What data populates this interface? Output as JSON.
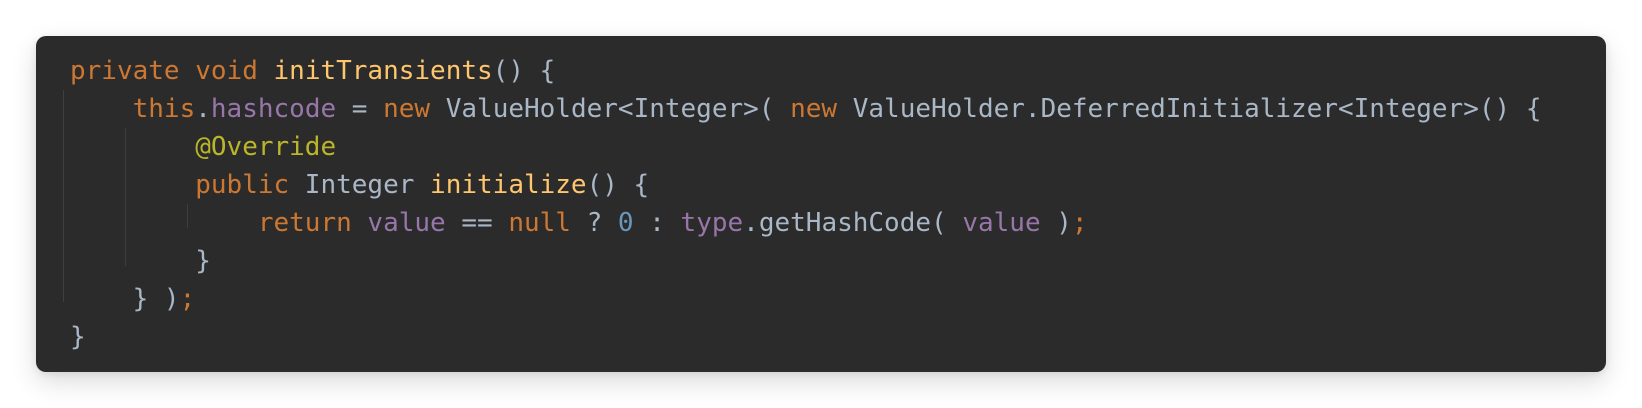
{
  "colors": {
    "background": "#2b2b2b",
    "keyword": "#cc7832",
    "method": "#ffc66d",
    "field": "#9876aa",
    "type": "#a9b7c6",
    "annotation": "#bbb529",
    "number": "#6897bb",
    "plain": "#a9b7c6"
  },
  "code": {
    "lines": [
      [
        {
          "text": "private",
          "kind": "keyword"
        },
        {
          "text": " ",
          "kind": "plain"
        },
        {
          "text": "void",
          "kind": "keyword"
        },
        {
          "text": " ",
          "kind": "plain"
        },
        {
          "text": "initTransients",
          "kind": "method"
        },
        {
          "text": "() {",
          "kind": "plain"
        }
      ],
      [
        {
          "text": "    ",
          "kind": "plain"
        },
        {
          "text": "this",
          "kind": "keyword"
        },
        {
          "text": ".",
          "kind": "plain"
        },
        {
          "text": "hashcode",
          "kind": "field"
        },
        {
          "text": " = ",
          "kind": "plain"
        },
        {
          "text": "new",
          "kind": "keyword"
        },
        {
          "text": " ValueHolder<Integer>( ",
          "kind": "plain"
        },
        {
          "text": "new",
          "kind": "keyword"
        },
        {
          "text": " ValueHolder.DeferredInitializer<Integer>() {",
          "kind": "plain"
        }
      ],
      [
        {
          "text": "        ",
          "kind": "plain"
        },
        {
          "text": "@Override",
          "kind": "annotation"
        }
      ],
      [
        {
          "text": "        ",
          "kind": "plain"
        },
        {
          "text": "public",
          "kind": "keyword"
        },
        {
          "text": " Integer ",
          "kind": "plain"
        },
        {
          "text": "initialize",
          "kind": "method"
        },
        {
          "text": "() {",
          "kind": "plain"
        }
      ],
      [
        {
          "text": "            ",
          "kind": "plain"
        },
        {
          "text": "return",
          "kind": "keyword"
        },
        {
          "text": " ",
          "kind": "plain"
        },
        {
          "text": "value",
          "kind": "field"
        },
        {
          "text": " == ",
          "kind": "plain"
        },
        {
          "text": "null",
          "kind": "keyword"
        },
        {
          "text": " ? ",
          "kind": "plain"
        },
        {
          "text": "0",
          "kind": "number"
        },
        {
          "text": " : ",
          "kind": "plain"
        },
        {
          "text": "type",
          "kind": "field"
        },
        {
          "text": ".getHashCode( ",
          "kind": "plain"
        },
        {
          "text": "value",
          "kind": "field"
        },
        {
          "text": " )",
          "kind": "plain"
        },
        {
          "text": ";",
          "kind": "keyword"
        }
      ],
      [
        {
          "text": "        }",
          "kind": "plain"
        }
      ],
      [
        {
          "text": "    } )",
          "kind": "plain"
        },
        {
          "text": ";",
          "kind": "keyword"
        }
      ],
      [
        {
          "text": "}",
          "kind": "plain"
        }
      ]
    ]
  }
}
